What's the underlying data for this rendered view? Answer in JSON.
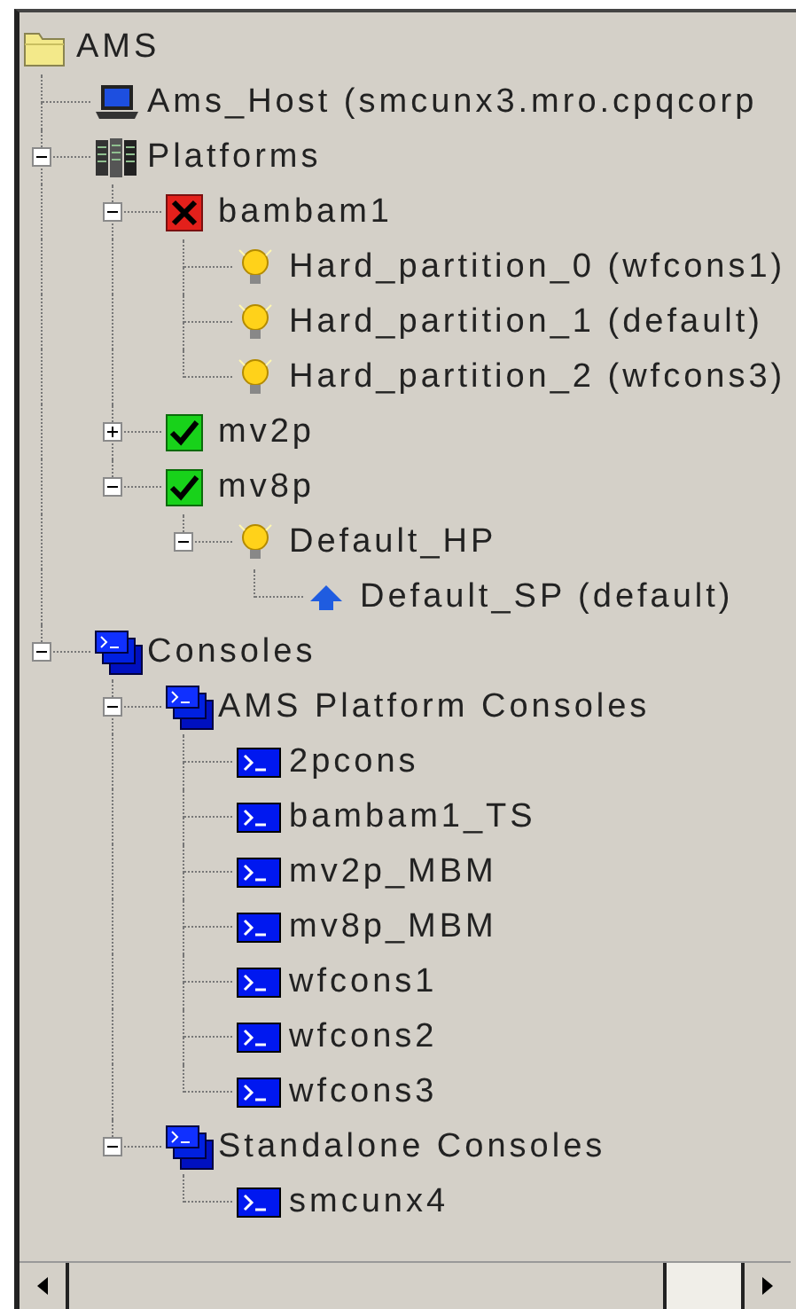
{
  "tree": [
    {
      "label": "AMS",
      "kind": "folder",
      "children": [
        {
          "label": "Ams_Host (smcunx3.mro.cpqcorp",
          "kind": "host"
        },
        {
          "label": "Platforms",
          "kind": "rack",
          "expanded": true,
          "children": [
            {
              "label": "bambam1",
              "kind": "error",
              "expanded": true,
              "children": [
                {
                  "label": "Hard_partition_0 (wfcons1)",
                  "kind": "bulb"
                },
                {
                  "label": "Hard_partition_1 (default)",
                  "kind": "bulb"
                },
                {
                  "label": "Hard_partition_2 (wfcons3)",
                  "kind": "bulb"
                }
              ]
            },
            {
              "label": "mv2p",
              "kind": "ok",
              "expanded": false
            },
            {
              "label": "mv8p",
              "kind": "ok",
              "expanded": true,
              "children": [
                {
                  "label": "Default_HP",
                  "kind": "bulb",
                  "expanded": true,
                  "children": [
                    {
                      "label": "Default_SP (default)",
                      "kind": "arrow"
                    }
                  ]
                }
              ]
            }
          ]
        },
        {
          "label": "Consoles",
          "kind": "consoles",
          "expanded": true,
          "children": [
            {
              "label": "AMS Platform Consoles",
              "kind": "consoles",
              "expanded": true,
              "children": [
                {
                  "label": "2pcons",
                  "kind": "console"
                },
                {
                  "label": "bambam1_TS",
                  "kind": "console"
                },
                {
                  "label": "mv2p_MBM",
                  "kind": "console"
                },
                {
                  "label": "mv8p_MBM",
                  "kind": "console"
                },
                {
                  "label": "wfcons1",
                  "kind": "console"
                },
                {
                  "label": "wfcons2",
                  "kind": "console"
                },
                {
                  "label": "wfcons3",
                  "kind": "console"
                }
              ]
            },
            {
              "label": "Standalone Consoles",
              "kind": "consoles",
              "expanded": true,
              "children": [
                {
                  "label": "smcunx4",
                  "kind": "console"
                }
              ]
            }
          ]
        }
      ]
    }
  ]
}
